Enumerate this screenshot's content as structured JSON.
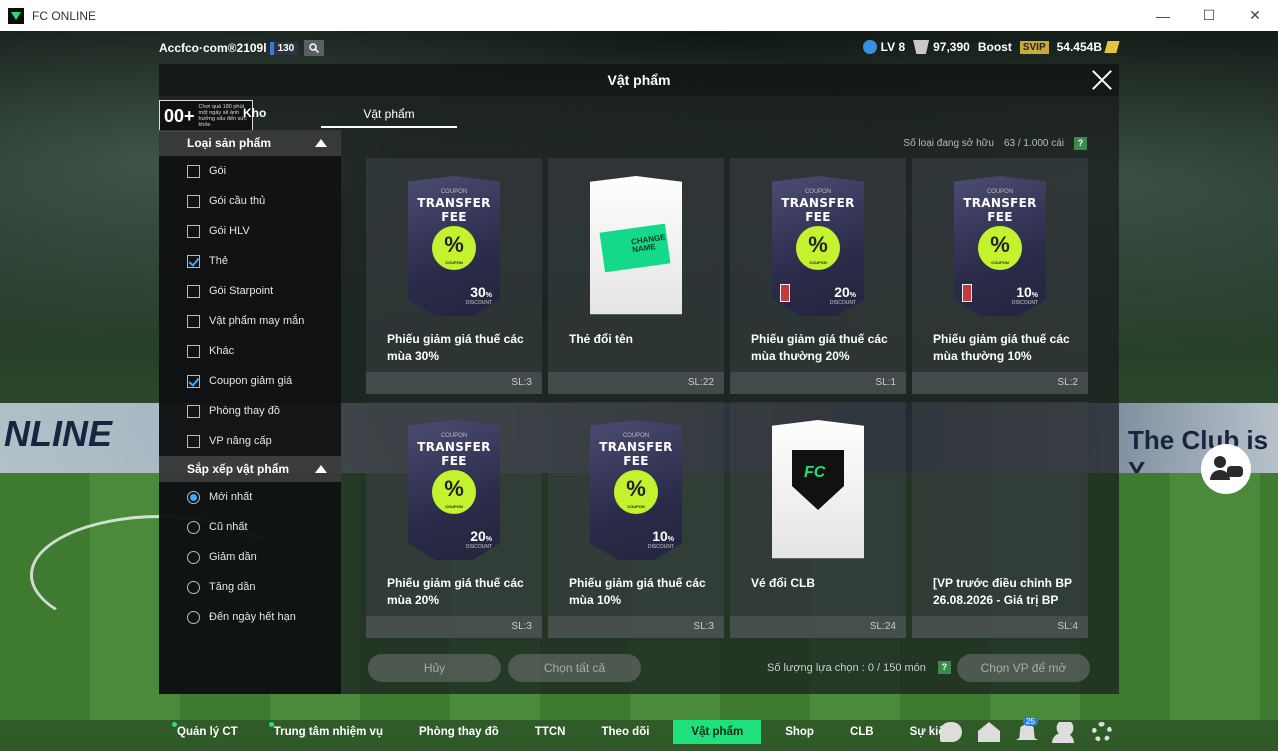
{
  "window": {
    "title": "FC ONLINE",
    "minimize": "—",
    "maximize": "☐",
    "close": "✕"
  },
  "hud": {
    "username": "Accfco·com®2109l",
    "level_badge": "130",
    "lv": "LV 8",
    "bp": "97,390",
    "boost": "Boost",
    "svip": "SVIP",
    "coins": "54.454B"
  },
  "modal": {
    "title": "Vật phẩm",
    "age_num": "00+",
    "age_note": "Chơi quá 180 phút một ngày sẽ ảnh hưởng xấu đến sức khỏe.",
    "tab_kho": "Kho",
    "tab_vatpham": "Vật phẩm",
    "owned_label": "Số loại đang sở hữu",
    "owned_value": "63 / 1.000 cái",
    "help": "?"
  },
  "sidebar": {
    "product_header": "Loại sản phẩm",
    "product_types": [
      {
        "label": "Gói",
        "checked": false
      },
      {
        "label": "Gói cầu thủ",
        "checked": false
      },
      {
        "label": "Gói HLV",
        "checked": false
      },
      {
        "label": "Thẻ",
        "checked": true
      },
      {
        "label": "Gói Starpoint",
        "checked": false
      },
      {
        "label": "Vật phẩm may mắn",
        "checked": false
      },
      {
        "label": "Khác",
        "checked": false
      },
      {
        "label": "Coupon giảm giá",
        "checked": true
      },
      {
        "label": "Phòng thay đồ",
        "checked": false
      },
      {
        "label": "VP nâng cấp",
        "checked": false
      }
    ],
    "sort_header": "Sắp xếp vật phẩm",
    "sort_options": [
      {
        "label": "Mới nhất",
        "selected": true
      },
      {
        "label": "Cũ nhất",
        "selected": false
      },
      {
        "label": "Giảm dần",
        "selected": false
      },
      {
        "label": "Tăng dần",
        "selected": false
      },
      {
        "label": "Đến ngày hết hạn",
        "selected": false
      }
    ]
  },
  "items": [
    {
      "name": "Phiếu giảm giá thuế các mùa 30%",
      "qty": "SL:3",
      "kind": "coupon",
      "pct": "30",
      "ban": false
    },
    {
      "name": "Thẻ đổi tên",
      "qty": "SL:22",
      "kind": "rename"
    },
    {
      "name": "Phiếu giảm giá thuế các mùa thường 20%",
      "qty": "SL:1",
      "kind": "coupon",
      "pct": "20",
      "ban": true
    },
    {
      "name": "Phiếu giảm giá thuế các mùa thường 10%",
      "qty": "SL:2",
      "kind": "coupon",
      "pct": "10",
      "ban": true
    },
    {
      "name": "Phiếu giảm giá thuế các mùa 20%",
      "qty": "SL:3",
      "kind": "coupon",
      "pct": "20",
      "ban": false
    },
    {
      "name": "Phiếu giảm giá thuế các mùa 10%",
      "qty": "SL:3",
      "kind": "coupon",
      "pct": "10",
      "ban": false
    },
    {
      "name": "Vé đổi CLB",
      "qty": "SL:24",
      "kind": "club"
    },
    {
      "name": "[VP trước điều chỉnh BP 26.08.2026 - Giá trị BP",
      "qty": "SL:4",
      "kind": "empty"
    }
  ],
  "coupon_text": {
    "small": "COUPON",
    "title": "TRANSFER FEE",
    "badge": "%",
    "badge_sub": "COUPON",
    "pct_suffix": "%",
    "discount": "DISCOUNT"
  },
  "rename_text": "CHANGE NAME",
  "actions": {
    "cancel": "Hủy",
    "select_all": "Chọn tất cả",
    "select_count_label": "Số lượng lựa chọn : 0 / 150 món",
    "open": "Chọn VP để mở"
  },
  "bottom_nav": [
    {
      "label": "Quản lý CT",
      "dot": true,
      "active": false
    },
    {
      "label": "Trung tâm nhiệm vụ",
      "dot": true,
      "active": false
    },
    {
      "label": "Phòng thay đồ",
      "dot": false,
      "active": false
    },
    {
      "label": "TTCN",
      "dot": false,
      "active": false
    },
    {
      "label": "Theo dõi",
      "dot": false,
      "active": false
    },
    {
      "label": "Vật phẩm",
      "dot": false,
      "active": true
    },
    {
      "label": "Shop",
      "dot": false,
      "active": false
    },
    {
      "label": "CLB",
      "dot": false,
      "active": false
    },
    {
      "label": "Sự kiện",
      "dot": false,
      "active": false
    }
  ],
  "notif_count": "25",
  "bg_text": {
    "left": "NLINE",
    "right": "The Club is Y"
  }
}
